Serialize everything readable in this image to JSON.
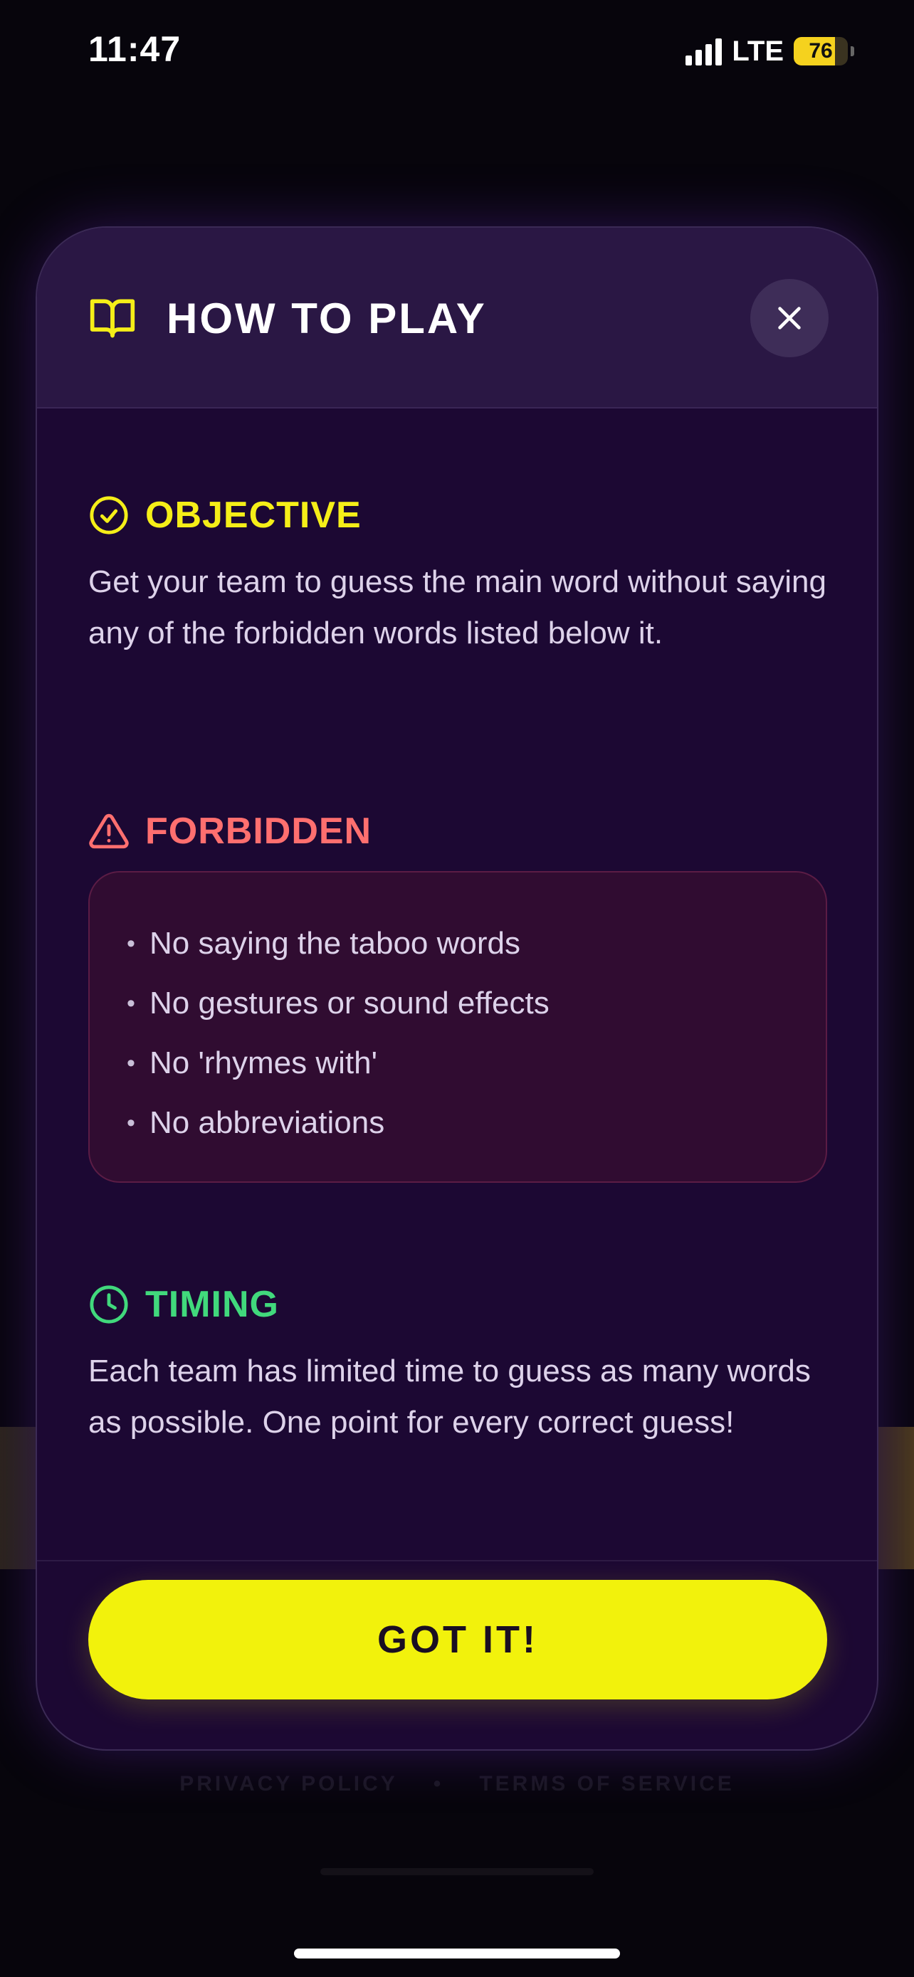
{
  "status_bar": {
    "time": "11:47",
    "network": "LTE",
    "battery_percent": "76",
    "battery_level": 0.76
  },
  "modal": {
    "title": "HOW TO PLAY",
    "title_icon": "book-open-icon",
    "close_icon": "close-icon",
    "sections": {
      "objective": {
        "title": "OBJECTIVE",
        "icon": "check-circle-icon",
        "color": "#f5ee18",
        "text": "Get your team to guess the main word without saying any of the forbidden words listed below it."
      },
      "forbidden": {
        "title": "FORBIDDEN",
        "icon": "warning-triangle-icon",
        "color": "#ff6f6f",
        "items": [
          "No saying the taboo words",
          "No gestures or sound effects",
          "No 'rhymes with'",
          "No abbreviations"
        ]
      },
      "timing": {
        "title": "TIMING",
        "icon": "clock-icon",
        "color": "#41d97c",
        "text": "Each team has limited time to guess as many words as possible. One point for every correct guess!"
      }
    },
    "confirm_label": "GOT IT!"
  },
  "background": {
    "privacy_label": "PRIVACY POLICY",
    "separator": "•",
    "terms_label": "TERMS OF SERVICE"
  },
  "colors": {
    "accent_yellow": "#f2f20c",
    "modal_bg": "#1c0833",
    "header_bg": "#2a1744"
  }
}
